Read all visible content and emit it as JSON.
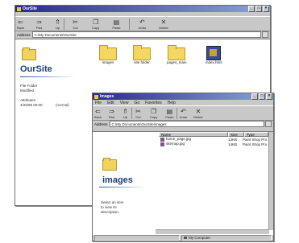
{
  "oursite_window": {
    "title": "OurSite",
    "toolbar": [
      "Back",
      "Fwd",
      "Up",
      "Cut",
      "Copy",
      "Paste",
      "Undo",
      "Delete"
    ],
    "address_label": "Address",
    "address": "C:\\My Documents\\OurSite",
    "panel_title": "OurSite",
    "panel_line1": "File Folder",
    "panel_line2": "Modified",
    "panel_line3": "4/26/98 00:00",
    "panel_line4": "Attributes",
    "panel_line5": "(normal)",
    "items": [
      "images",
      "site folder",
      "pages_main",
      "index.html"
    ]
  },
  "images_window": {
    "title": "Images",
    "menu": [
      "File",
      "Edit",
      "View",
      "Go",
      "Favorites",
      "Help"
    ],
    "toolbar": [
      "Back",
      "Fwd",
      "Up",
      "Cut",
      "Copy",
      "Paste",
      "Undo",
      "Delete"
    ],
    "address_label": "Address",
    "address": "C:\\My Documents\\OurSite\\images",
    "panel_title": "images",
    "panel_line1": "Select an item",
    "panel_line2": "to view its",
    "panel_line3": "description.",
    "columns": [
      "Name",
      "Size",
      "Type"
    ],
    "files": [
      {
        "name": "home_page.jpg",
        "size": "13KB",
        "type": "Paint Shop Pro Ima..."
      },
      {
        "name": "sitemap.jpg",
        "size": "14KB",
        "type": "Paint Shop Pro Ima..."
      }
    ],
    "status": "My Computer"
  }
}
